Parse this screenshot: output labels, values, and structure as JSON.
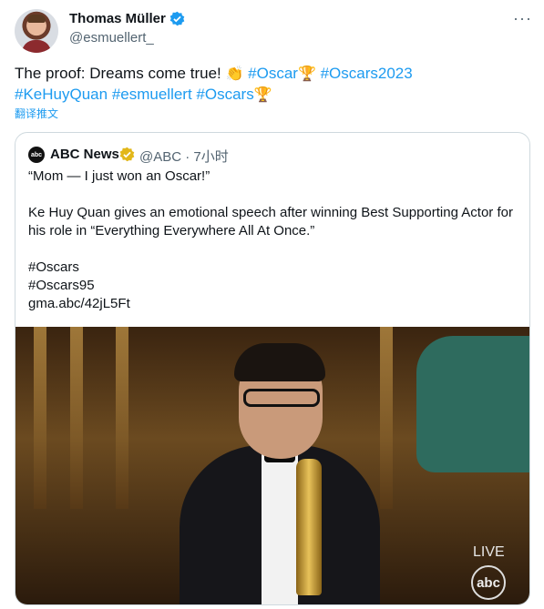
{
  "author": {
    "name": "Thomas Müller",
    "handle": "@esmuellert_"
  },
  "tweet": {
    "text_before": "The proof: Dreams come true! ",
    "line1_tags": [
      "#Oscar",
      "#Oscars2023"
    ],
    "line2_tags": [
      "#KeHuyQuan",
      "#esmuellert",
      "#Oscars"
    ],
    "translate_label": "翻译推文"
  },
  "quote": {
    "logo_text": "abc",
    "name": "ABC News",
    "meta": "@ABC · 7小时",
    "text": "“Mom — I just won an Oscar!”\n\nKe Huy Quan gives an emotional speech after winning Best Supporting Actor for his role in “Everything Everywhere All At Once.”\n\n#Oscars\n#Oscars95\ngma.abc/42jL5Ft",
    "media": {
      "live_label": "LIVE",
      "network_logo": "abc"
    }
  },
  "colors": {
    "accent": "#1d9bf0",
    "muted": "#536471",
    "verified_gold": "#e2b719"
  },
  "icons": [
    "verified-badge-icon",
    "more-icon",
    "clapping-hands-emoji",
    "oscar-trophy-emoji"
  ]
}
